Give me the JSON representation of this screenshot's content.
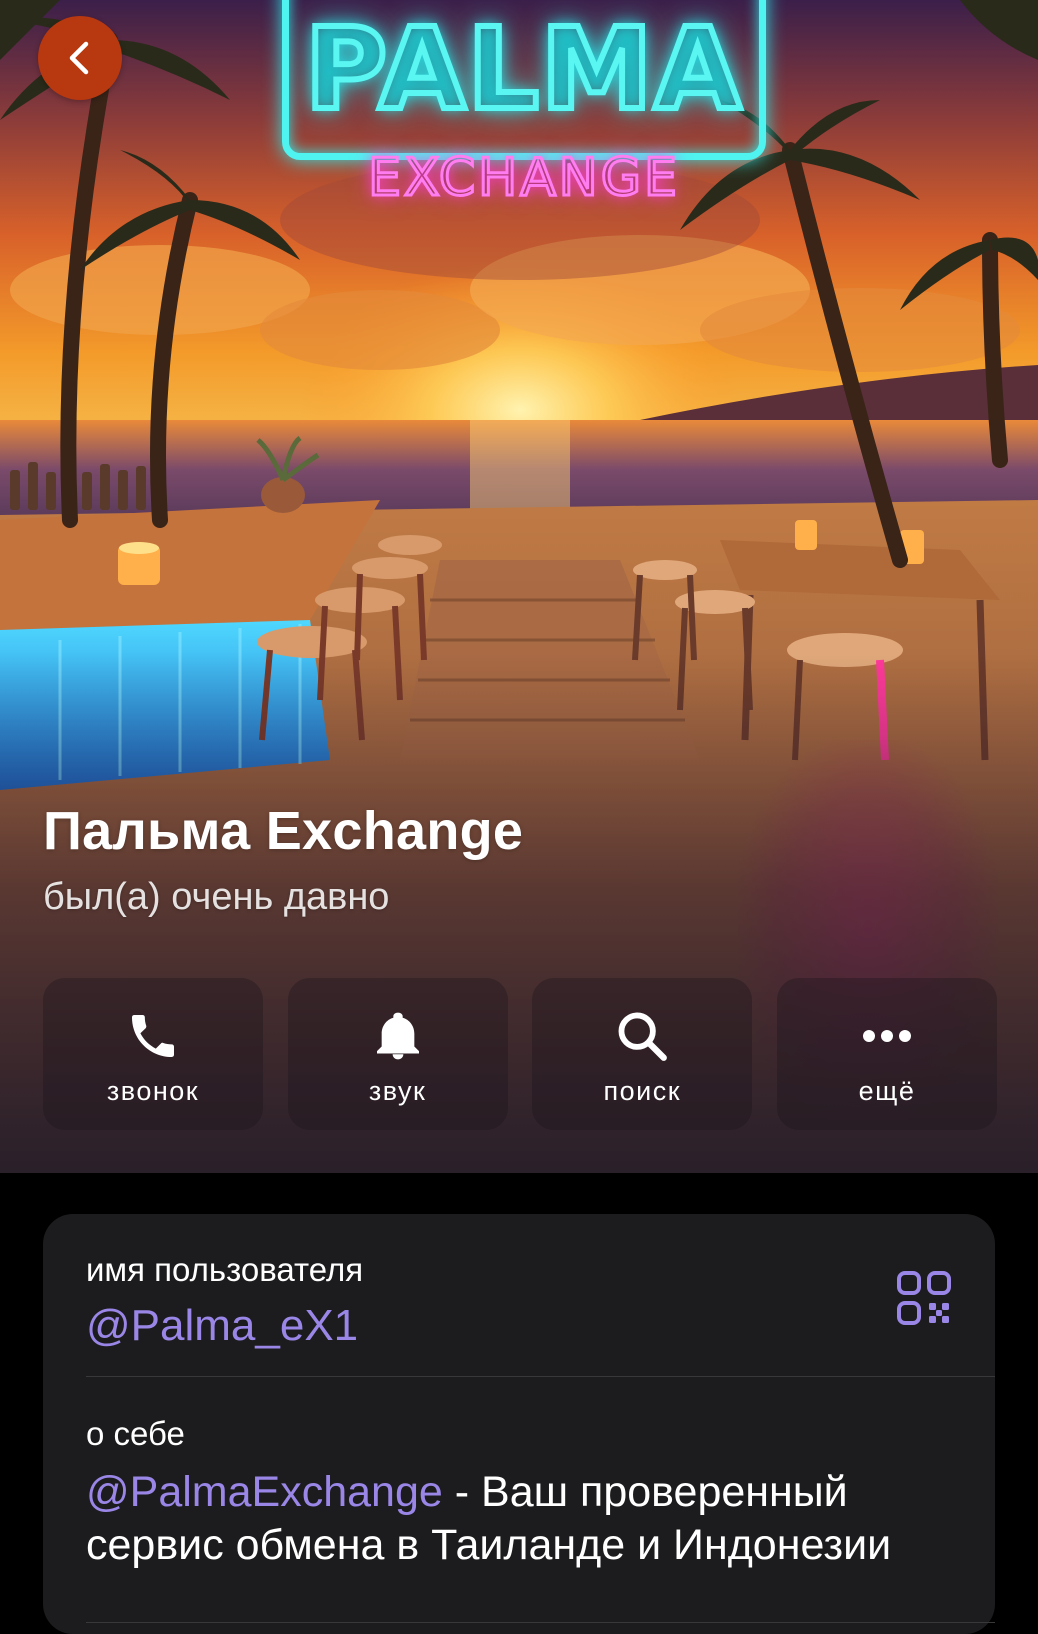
{
  "hero": {
    "neon_title": "PALMA",
    "neon_subtitle": "EXCHANGE"
  },
  "nav": {
    "back_icon": "chevron-left-icon"
  },
  "profile": {
    "name": "Пальма Exchange",
    "status": "был(а) очень давно"
  },
  "actions": [
    {
      "label": "звонок",
      "icon": "phone-icon"
    },
    {
      "label": "звук",
      "icon": "bell-icon"
    },
    {
      "label": "поиск",
      "icon": "search-icon"
    },
    {
      "label": "ещё",
      "icon": "more-icon"
    }
  ],
  "info": {
    "username_label": "имя пользователя",
    "username_value": "@Palma_eX1",
    "qr_icon": "qr-code-icon",
    "about_label": "о себе",
    "about_mention": "@PalmaExchange",
    "about_text": " - Ваш проверенный сервис обмена в Таиланде и Индонезии"
  },
  "colors": {
    "accent": "#9a86e6",
    "back_button": "#b8380f",
    "card_bg": "#1c1c1e",
    "page_bg": "#000000"
  }
}
